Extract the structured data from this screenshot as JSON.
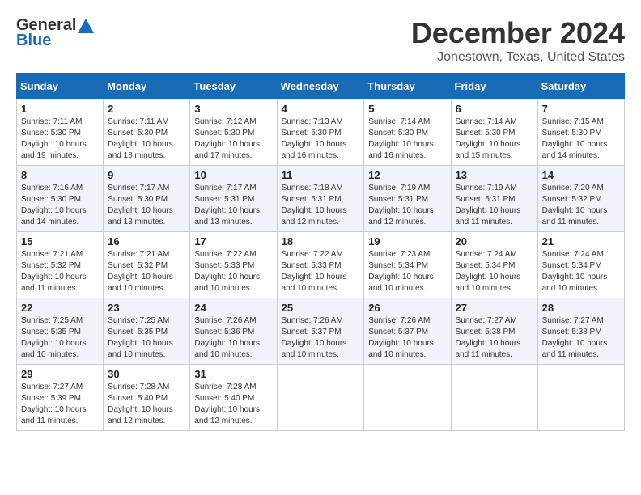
{
  "header": {
    "logo_general": "General",
    "logo_blue": "Blue",
    "month": "December 2024",
    "location": "Jonestown, Texas, United States"
  },
  "days_of_week": [
    "Sunday",
    "Monday",
    "Tuesday",
    "Wednesday",
    "Thursday",
    "Friday",
    "Saturday"
  ],
  "weeks": [
    [
      {
        "day": "1",
        "sunrise": "7:11 AM",
        "sunset": "5:30 PM",
        "daylight": "10 hours and 19 minutes."
      },
      {
        "day": "2",
        "sunrise": "7:11 AM",
        "sunset": "5:30 PM",
        "daylight": "10 hours and 18 minutes."
      },
      {
        "day": "3",
        "sunrise": "7:12 AM",
        "sunset": "5:30 PM",
        "daylight": "10 hours and 17 minutes."
      },
      {
        "day": "4",
        "sunrise": "7:13 AM",
        "sunset": "5:30 PM",
        "daylight": "10 hours and 16 minutes."
      },
      {
        "day": "5",
        "sunrise": "7:14 AM",
        "sunset": "5:30 PM",
        "daylight": "10 hours and 16 minutes."
      },
      {
        "day": "6",
        "sunrise": "7:14 AM",
        "sunset": "5:30 PM",
        "daylight": "10 hours and 15 minutes."
      },
      {
        "day": "7",
        "sunrise": "7:15 AM",
        "sunset": "5:30 PM",
        "daylight": "10 hours and 14 minutes."
      }
    ],
    [
      {
        "day": "8",
        "sunrise": "7:16 AM",
        "sunset": "5:30 PM",
        "daylight": "10 hours and 14 minutes."
      },
      {
        "day": "9",
        "sunrise": "7:17 AM",
        "sunset": "5:30 PM",
        "daylight": "10 hours and 13 minutes."
      },
      {
        "day": "10",
        "sunrise": "7:17 AM",
        "sunset": "5:31 PM",
        "daylight": "10 hours and 13 minutes."
      },
      {
        "day": "11",
        "sunrise": "7:18 AM",
        "sunset": "5:31 PM",
        "daylight": "10 hours and 12 minutes."
      },
      {
        "day": "12",
        "sunrise": "7:19 AM",
        "sunset": "5:31 PM",
        "daylight": "10 hours and 12 minutes."
      },
      {
        "day": "13",
        "sunrise": "7:19 AM",
        "sunset": "5:31 PM",
        "daylight": "10 hours and 11 minutes."
      },
      {
        "day": "14",
        "sunrise": "7:20 AM",
        "sunset": "5:32 PM",
        "daylight": "10 hours and 11 minutes."
      }
    ],
    [
      {
        "day": "15",
        "sunrise": "7:21 AM",
        "sunset": "5:32 PM",
        "daylight": "10 hours and 11 minutes."
      },
      {
        "day": "16",
        "sunrise": "7:21 AM",
        "sunset": "5:32 PM",
        "daylight": "10 hours and 10 minutes."
      },
      {
        "day": "17",
        "sunrise": "7:22 AM",
        "sunset": "5:33 PM",
        "daylight": "10 hours and 10 minutes."
      },
      {
        "day": "18",
        "sunrise": "7:22 AM",
        "sunset": "5:33 PM",
        "daylight": "10 hours and 10 minutes."
      },
      {
        "day": "19",
        "sunrise": "7:23 AM",
        "sunset": "5:34 PM",
        "daylight": "10 hours and 10 minutes."
      },
      {
        "day": "20",
        "sunrise": "7:24 AM",
        "sunset": "5:34 PM",
        "daylight": "10 hours and 10 minutes."
      },
      {
        "day": "21",
        "sunrise": "7:24 AM",
        "sunset": "5:34 PM",
        "daylight": "10 hours and 10 minutes."
      }
    ],
    [
      {
        "day": "22",
        "sunrise": "7:25 AM",
        "sunset": "5:35 PM",
        "daylight": "10 hours and 10 minutes."
      },
      {
        "day": "23",
        "sunrise": "7:25 AM",
        "sunset": "5:35 PM",
        "daylight": "10 hours and 10 minutes."
      },
      {
        "day": "24",
        "sunrise": "7:26 AM",
        "sunset": "5:36 PM",
        "daylight": "10 hours and 10 minutes."
      },
      {
        "day": "25",
        "sunrise": "7:26 AM",
        "sunset": "5:37 PM",
        "daylight": "10 hours and 10 minutes."
      },
      {
        "day": "26",
        "sunrise": "7:26 AM",
        "sunset": "5:37 PM",
        "daylight": "10 hours and 10 minutes."
      },
      {
        "day": "27",
        "sunrise": "7:27 AM",
        "sunset": "5:38 PM",
        "daylight": "10 hours and 11 minutes."
      },
      {
        "day": "28",
        "sunrise": "7:27 AM",
        "sunset": "5:38 PM",
        "daylight": "10 hours and 11 minutes."
      }
    ],
    [
      {
        "day": "29",
        "sunrise": "7:27 AM",
        "sunset": "5:39 PM",
        "daylight": "10 hours and 11 minutes."
      },
      {
        "day": "30",
        "sunrise": "7:28 AM",
        "sunset": "5:40 PM",
        "daylight": "10 hours and 12 minutes."
      },
      {
        "day": "31",
        "sunrise": "7:28 AM",
        "sunset": "5:40 PM",
        "daylight": "10 hours and 12 minutes."
      },
      null,
      null,
      null,
      null
    ]
  ],
  "labels": {
    "sunrise": "Sunrise:",
    "sunset": "Sunset:",
    "daylight": "Daylight:"
  }
}
